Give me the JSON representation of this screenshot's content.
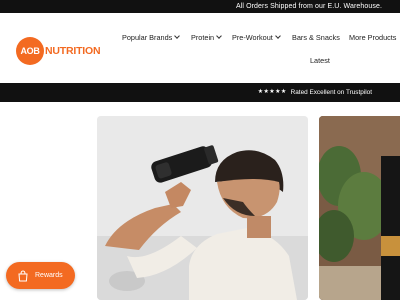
{
  "topbar": {
    "text": "All Orders Shipped from our E.U. Warehouse."
  },
  "logo": {
    "mark": "AOB",
    "wordmark": "NUTRITION"
  },
  "nav": {
    "items": [
      {
        "label": "Popular Brands",
        "has_dropdown": true
      },
      {
        "label": "Protein",
        "has_dropdown": true
      },
      {
        "label": "Pre-Workout",
        "has_dropdown": true
      },
      {
        "label": "Bars & Snacks",
        "has_dropdown": false
      },
      {
        "label": "More Products",
        "has_dropdown": false
      },
      {
        "label": "Latest",
        "has_dropdown": false
      }
    ]
  },
  "trust": {
    "stars": "★★★★★",
    "text": "Rated Excellent on Trustpilot"
  },
  "rewards": {
    "label": "Rewards",
    "icon": "shopping-bag-icon"
  },
  "colors": {
    "brand_orange": "#f36a21",
    "dark_bar": "#111111"
  }
}
